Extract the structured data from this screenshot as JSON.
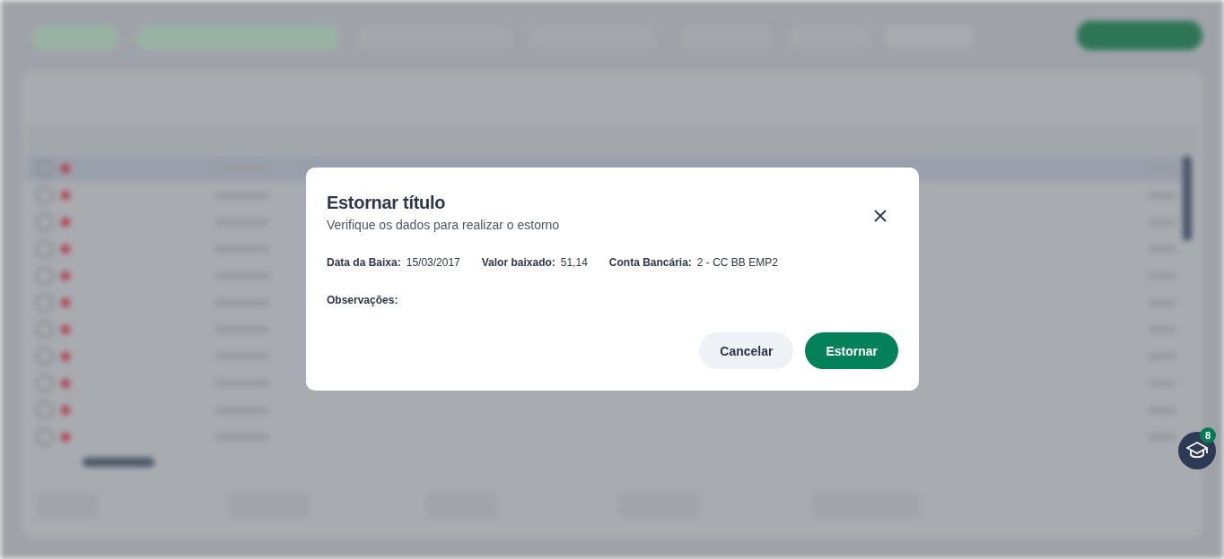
{
  "dialog": {
    "title": "Estornar título",
    "subtitle": "Verifique os dados para realizar o estorno",
    "fields": [
      {
        "label": "Data da Baixa:",
        "value": "15/03/2017"
      },
      {
        "label": "Valor baixado:",
        "value": "51,14"
      },
      {
        "label": "Conta Bancária:",
        "value": "2 - CC BB EMP2"
      }
    ],
    "notes_label": "Observações:",
    "buttons": [
      {
        "label": "Cancelar",
        "kind": "secondary"
      },
      {
        "label": "Estornar",
        "kind": "primary"
      }
    ]
  },
  "help_button": {
    "badge": "8"
  }
}
